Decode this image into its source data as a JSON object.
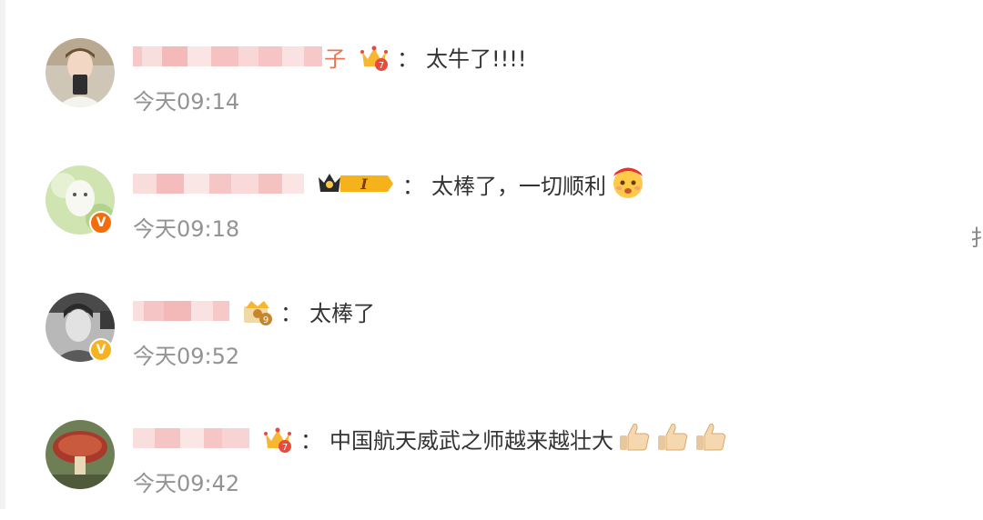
{
  "comments": [
    {
      "username_suffix": "子",
      "text": "太牛了!!!!",
      "time": "今天09:14",
      "badge_icon": "crown-level-7-badge",
      "verified": false
    },
    {
      "username_suffix": "",
      "text": "太棒了，一切顺利",
      "time": "今天09:18",
      "badge_icon": "crown-level-1-badge",
      "verified": true,
      "verified_color": "#f56c0b",
      "emoji": "cheer-emoji"
    },
    {
      "username_suffix": "",
      "text": "太棒了",
      "time": "今天09:52",
      "badge_icon": "crown-level-9-badge",
      "verified": true,
      "verified_color": "#f6b221"
    },
    {
      "username_suffix": "",
      "text": "中国航天威武之师越来越壮大",
      "time": "今天09:42",
      "badge_icon": "crown-level-7-badge",
      "verified": false,
      "emoji": "thumbs-up-emoji"
    }
  ],
  "colon": "：",
  "verified_mark": "V",
  "badge_levels": [
    "7",
    "I",
    "9",
    "7"
  ],
  "edge_char": "扌"
}
